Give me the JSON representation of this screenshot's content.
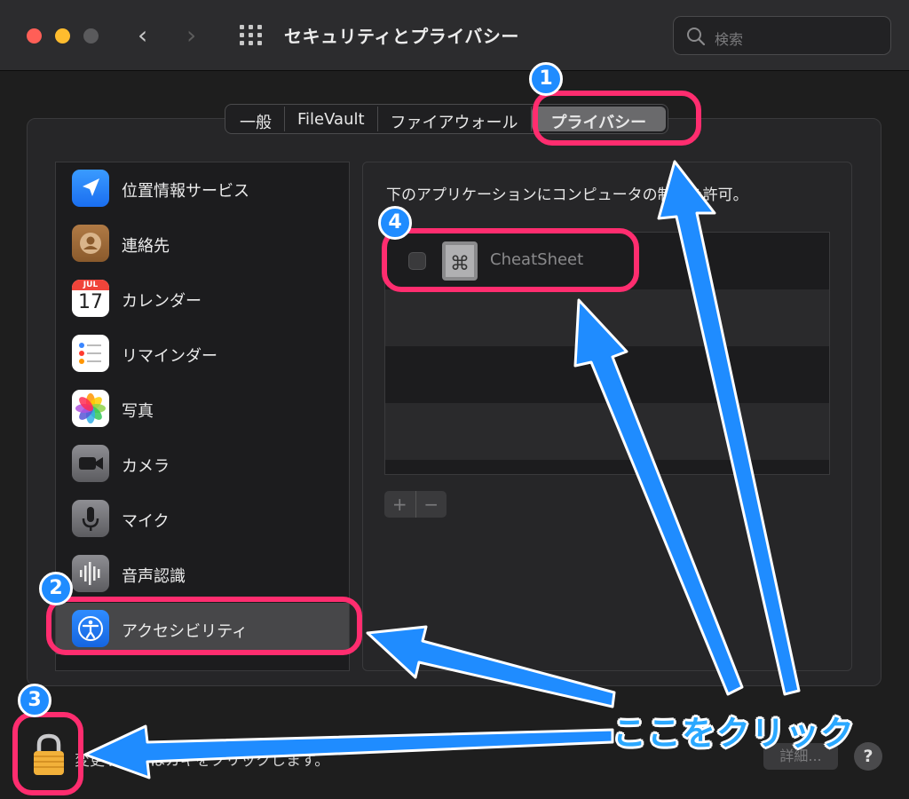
{
  "window": {
    "title": "セキュリティとプライバシー"
  },
  "search": {
    "placeholder": "検索"
  },
  "tabs": [
    {
      "label": "一般"
    },
    {
      "label": "FileVault"
    },
    {
      "label": "ファイアウォール"
    },
    {
      "label": "プライバシー",
      "selected": true
    }
  ],
  "sidebar": {
    "items": [
      {
        "label": "位置情報サービス",
        "icon": "location-arrow-icon"
      },
      {
        "label": "連絡先",
        "icon": "contacts-icon"
      },
      {
        "label": "カレンダー",
        "icon": "calendar-icon",
        "month": "JUL",
        "day": "17"
      },
      {
        "label": "リマインダー",
        "icon": "reminders-icon"
      },
      {
        "label": "写真",
        "icon": "photos-icon"
      },
      {
        "label": "カメラ",
        "icon": "camera-icon"
      },
      {
        "label": "マイク",
        "icon": "microphone-icon"
      },
      {
        "label": "音声認識",
        "icon": "speech-recognition-icon"
      },
      {
        "label": "アクセシビリティ",
        "icon": "accessibility-icon",
        "selected": true
      }
    ]
  },
  "main": {
    "description": "下のアプリケーションにコンピュータの制御を許可。",
    "apps": [
      {
        "name": "CheatSheet",
        "checked": false
      }
    ],
    "add_label": "+",
    "remove_label": "−"
  },
  "footer": {
    "lock_text": "変更するにはカギをクリックします。",
    "details_label": "詳細...",
    "help_label": "?"
  },
  "annotations": {
    "badge1": "1",
    "badge2": "2",
    "badge3": "3",
    "badge4": "4",
    "callout": "ここをクリック"
  },
  "colors": {
    "highlight": "#ff2d6f",
    "arrow": "#1f8cff",
    "window_bg": "#1e1e1e"
  }
}
